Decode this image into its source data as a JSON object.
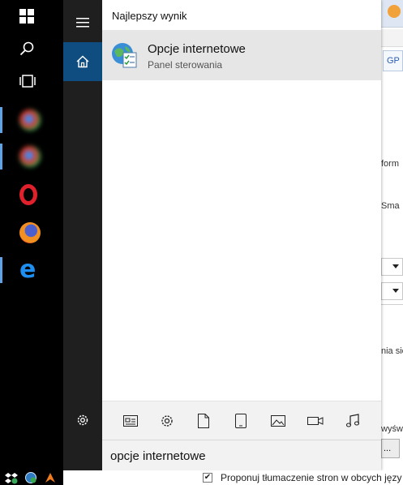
{
  "search_panel": {
    "header": "Najlepszy wynik",
    "best_result": {
      "title": "Opcje internetowe",
      "subtitle": "Panel sterowania",
      "icon": "globe-checklist-icon"
    },
    "filters": [
      {
        "name": "apps-filter-icon"
      },
      {
        "name": "settings-filter-icon"
      },
      {
        "name": "documents-filter-icon"
      },
      {
        "name": "tablet-filter-icon"
      },
      {
        "name": "photos-filter-icon"
      },
      {
        "name": "videos-filter-icon"
      },
      {
        "name": "music-filter-icon"
      }
    ],
    "query": "opcje internetowe"
  },
  "taskbar": {
    "buttons": [
      "windows-start-icon",
      "search-icon",
      "task-view-icon"
    ],
    "apps": [
      "chrome-icon",
      "chrome-icon",
      "opera-icon",
      "firefox-icon",
      "edge-icon"
    ]
  },
  "start_nav": {
    "items": [
      "hamburger-menu-icon",
      "home-icon",
      "settings-gear-icon"
    ]
  },
  "background_window": {
    "tab_button": "GP",
    "fragments": [
      "form",
      "Sma",
      "nia sie",
      "wyśw"
    ],
    "button_label": "...",
    "checkbox_label": "Proponuj tłumaczenie stron w obcych języ"
  },
  "colors": {
    "taskbar": "#000000",
    "nav": "#1f1f1f",
    "active": "#0f4d80",
    "accent": "#5ea3e8",
    "panel": "#ffffff",
    "result_bg": "#e6e6e6"
  }
}
